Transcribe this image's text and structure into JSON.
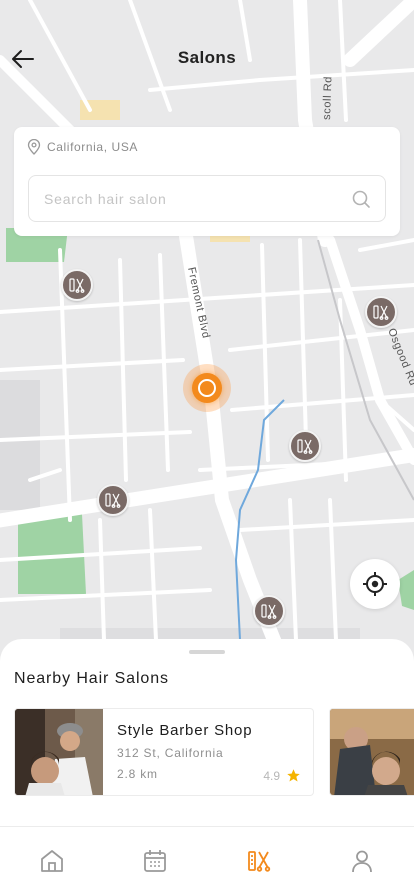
{
  "header": {
    "title": "Salons",
    "back_icon": "arrow-left-icon"
  },
  "search": {
    "location": "California, USA",
    "placeholder": "Search hair salon",
    "value": ""
  },
  "map": {
    "street_labels": [
      "Fremont Blvd",
      "Osgood Rd",
      "scoll Rd"
    ],
    "markers": [
      "salon-marker",
      "salon-marker",
      "salon-marker",
      "salon-marker",
      "salon-marker"
    ],
    "current_location_color": "#f38a1d"
  },
  "nearby": {
    "title": "Nearby Hair Salons",
    "salons": [
      {
        "name": "Style Barber Shop",
        "address": "312 St, California",
        "distance": "2.8 km",
        "rating": "4.9"
      },
      {
        "name": "",
        "address": "",
        "distance": "",
        "rating": ""
      }
    ]
  },
  "tabs": [
    {
      "icon": "home-icon",
      "active": false
    },
    {
      "icon": "calendar-icon",
      "active": false
    },
    {
      "icon": "salon-scissors-icon",
      "active": true
    },
    {
      "icon": "profile-icon",
      "active": false
    }
  ],
  "colors": {
    "accent": "#f38a1d",
    "star": "#f5b400",
    "marker": "#7a6a66",
    "map_bg": "#e9e9ea",
    "park": "#9fd3a4"
  }
}
